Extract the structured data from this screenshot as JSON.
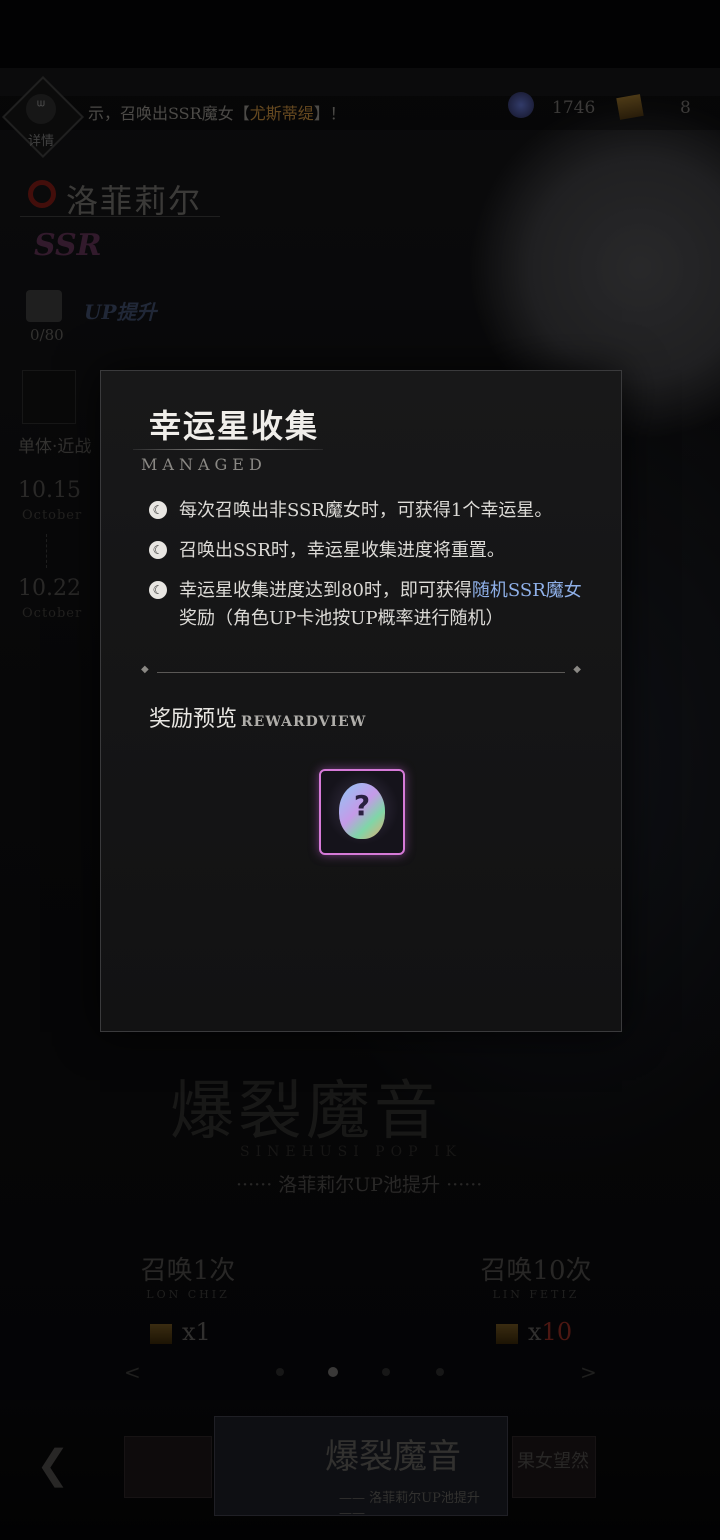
{
  "topbar": {
    "detail_label": "详情",
    "notice_prefix": "示，召唤出SSR魔女【",
    "notice_highlight": "尤斯蒂缇",
    "notice_suffix": "】！",
    "currency_1": "1746",
    "currency_2": "8"
  },
  "character": {
    "name": "洛菲莉尔",
    "rarity": "SSR",
    "up_tag": "UP提升",
    "progress": "0/80",
    "skill_type": "单体·近战",
    "start_date": "10.15",
    "start_month": "October",
    "end_date": "10.22",
    "end_month": "October"
  },
  "banner": {
    "title": "爆裂魔音",
    "subtitle_en": "SINEHUSI POP IK",
    "subtitle": "······ 洛菲莉尔UP池提升 ······",
    "summon_1": {
      "label": "召唤1次",
      "en": "LON CHIZ",
      "cost_prefix": "x",
      "cost": "1"
    },
    "summon_10": {
      "label": "召唤10次",
      "en": "LIN FETIZ",
      "cost_prefix": "x",
      "cost": "10"
    },
    "pager_left": "<",
    "pager_right": ">"
  },
  "bottom": {
    "main_thumb_title": "爆裂魔音",
    "main_thumb_sub": "—— 洛菲莉尔UP池提升 ——",
    "side_thumb_title": "果女望然"
  },
  "modal": {
    "title": "幸运星收集",
    "subtitle": "MANAGED",
    "rule_1": "每次召唤出非SSR魔女时，可获得1个幸运星。",
    "rule_2": "召唤出SSR时，幸运星收集进度将重置。",
    "rule_3_prefix": "幸运星收集进度达到80时，即可获得",
    "rule_3_link": "随机SSR魔女",
    "rule_3_suffix": "奖励（角色UP卡池按UP概率进行随机）",
    "reward_title": "奖励预览",
    "reward_title_en": "REWARDVIEW",
    "reward_item_icon": "?"
  },
  "colors": {
    "accent_link": "#8fb0e8",
    "reward_border": "#d67ad8",
    "highlight_gold": "#b9843a",
    "cost_red": "#8a2a22"
  }
}
